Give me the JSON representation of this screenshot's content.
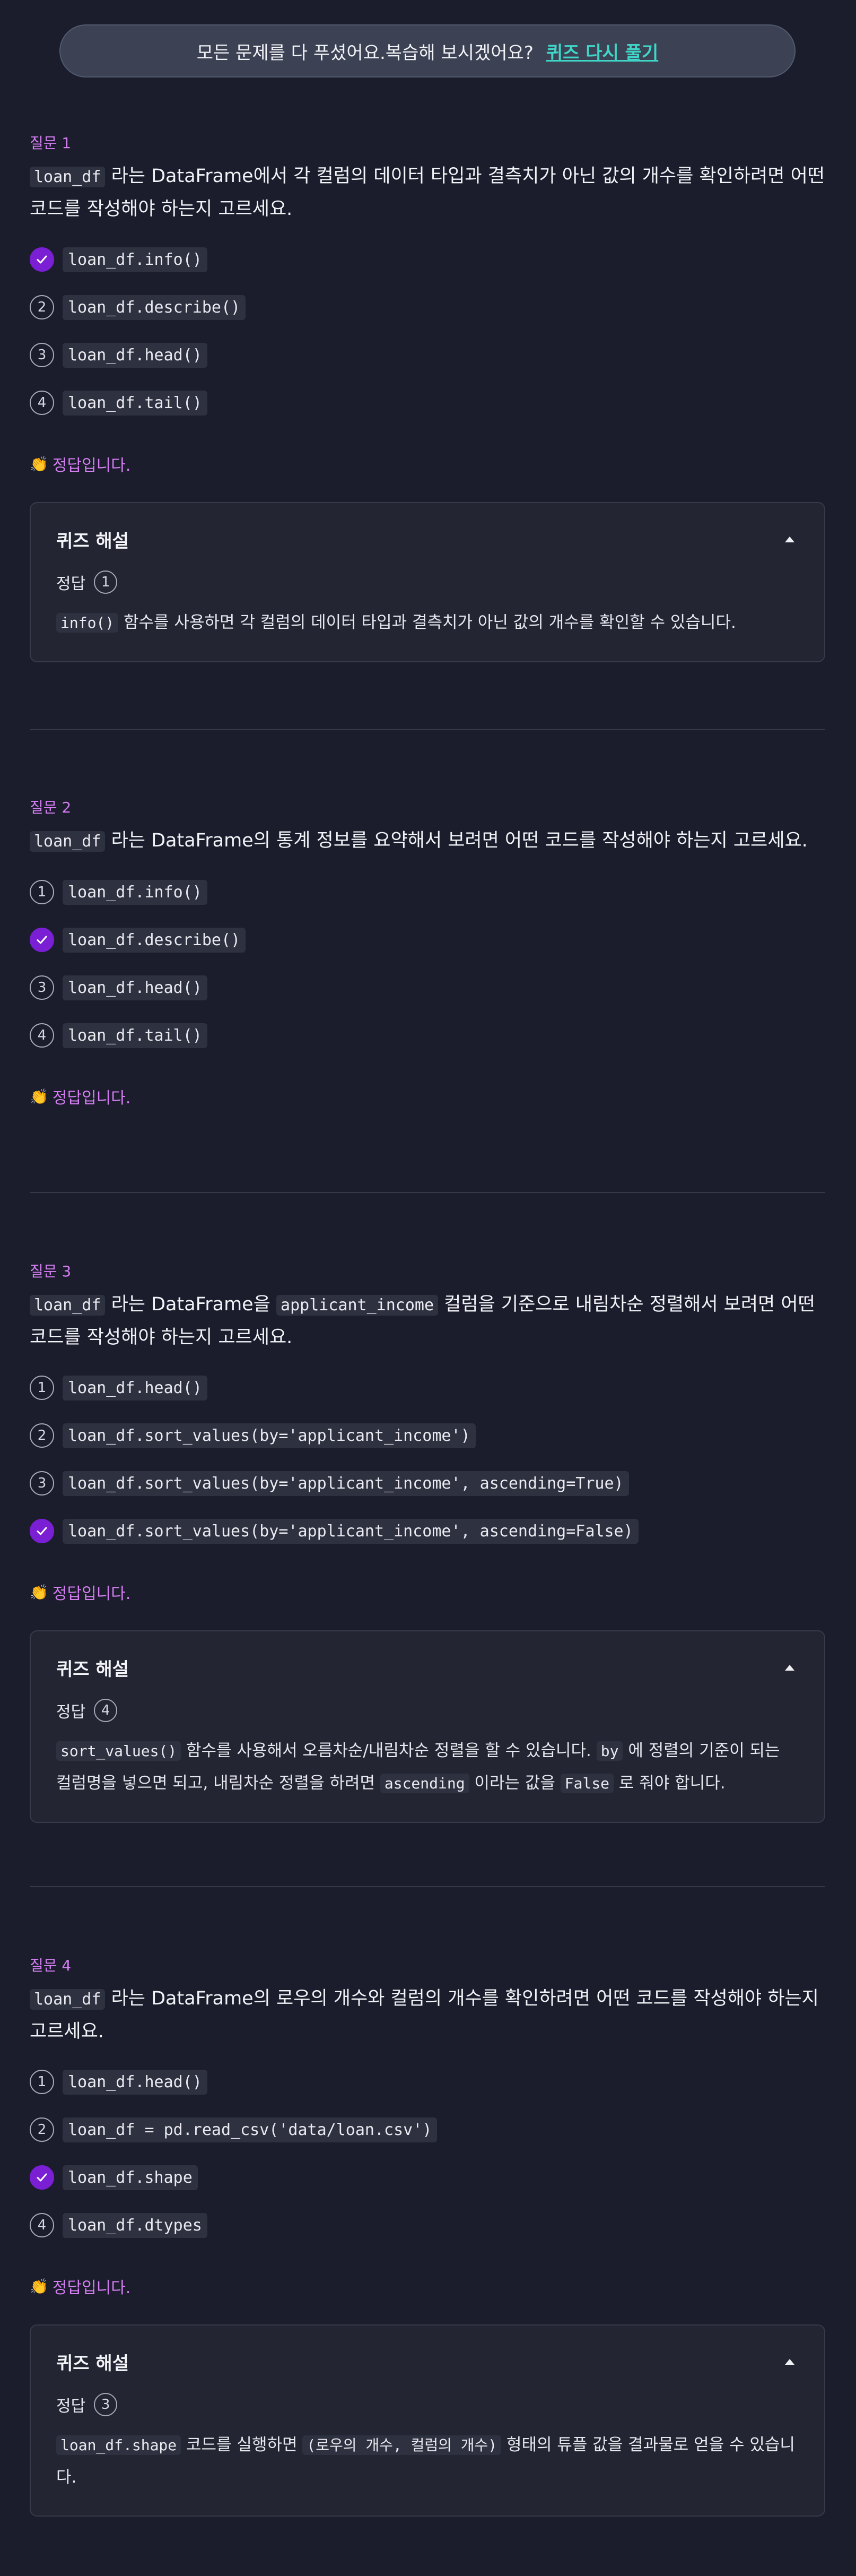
{
  "banner": {
    "text": "모든 문제를 다 푸셨어요.복습해 보시겠어요?",
    "retry": "퀴즈 다시 풀기"
  },
  "result_text": "정답입니다.",
  "result_icon": "clapping-hands-icon",
  "expl_title": "퀴즈 해설",
  "answer_label": "정답",
  "questions": [
    {
      "label": "질문 1",
      "text": {
        "c1": "loan_df",
        "t1": " 라는 DataFrame에서 각 컬럼의 데이터 타입과 결측치가 아닌 값의 개수를 확인하려면 어떤 코드를 작성해야 하는지 고르세요."
      },
      "options": [
        {
          "num": "1",
          "code": "loan_df.info()"
        },
        {
          "num": "2",
          "code": "loan_df.describe()"
        },
        {
          "num": "3",
          "code": "loan_df.head()"
        },
        {
          "num": "4",
          "code": "loan_df.tail()"
        }
      ],
      "answer": "1",
      "explanation": {
        "c1": "info()",
        "t1": " 함수를 사용하면 각 컬럼의 데이터 타입과 결측치가 아닌 값의 개수를 확인할 수 있습니다."
      }
    },
    {
      "label": "질문 2",
      "text": {
        "c1": "loan_df",
        "t1": " 라는 DataFrame의 통계 정보를 요약해서 보려면 어떤 코드를 작성해야 하는지 고르세요."
      },
      "options": [
        {
          "num": "1",
          "code": "loan_df.info()"
        },
        {
          "num": "2",
          "code": "loan_df.describe()"
        },
        {
          "num": "3",
          "code": "loan_df.head()"
        },
        {
          "num": "4",
          "code": "loan_df.tail()"
        }
      ],
      "answer": "2"
    },
    {
      "label": "질문 3",
      "text": {
        "c1": "loan_df",
        "t1": " 라는 DataFrame을 ",
        "c2": "applicant_income",
        "t2": " 컬럼을 기준으로 내림차순 정렬해서 보려면 어떤 코드를 작성해야 하는지 고르세요."
      },
      "options": [
        {
          "num": "1",
          "code": "loan_df.head()"
        },
        {
          "num": "2",
          "code": "loan_df.sort_values(by='applicant_income')"
        },
        {
          "num": "3",
          "code": "loan_df.sort_values(by='applicant_income', ascending=True)"
        },
        {
          "num": "4",
          "code": "loan_df.sort_values(by='applicant_income', ascending=False)"
        }
      ],
      "answer": "4",
      "explanation": {
        "c1": "sort_values()",
        "t1": " 함수를 사용해서 오름차순/내림차순 정렬을 할 수 있습니다. ",
        "c2": "by",
        "t2": " 에 정렬의 기준이 되는 컬럼명을 넣으면 되고, 내림차순 정렬을 하려면 ",
        "c3": "ascending",
        "t3": " 이라는 값을 ",
        "c4": "False",
        "t4": " 로 줘야 합니다."
      }
    },
    {
      "label": "질문 4",
      "text": {
        "c1": "loan_df",
        "t1": " 라는 DataFrame의 로우의 개수와 컬럼의 개수를 확인하려면 어떤 코드를 작성해야 하는지 고르세요."
      },
      "options": [
        {
          "num": "1",
          "code": "loan_df.head()"
        },
        {
          "num": "2",
          "code": "loan_df = pd.read_csv('data/loan.csv')"
        },
        {
          "num": "3",
          "code": "loan_df.shape"
        },
        {
          "num": "4",
          "code": "loan_df.dtypes"
        }
      ],
      "answer": "3",
      "explanation": {
        "c1": "loan_df.shape",
        "t1": " 코드를 실행하면 ",
        "c2": "(로우의 개수, 컬럼의 개수)",
        "t2": " 형태의 튜플 값을 결과물로 얻을 수 있습니다."
      }
    }
  ]
}
